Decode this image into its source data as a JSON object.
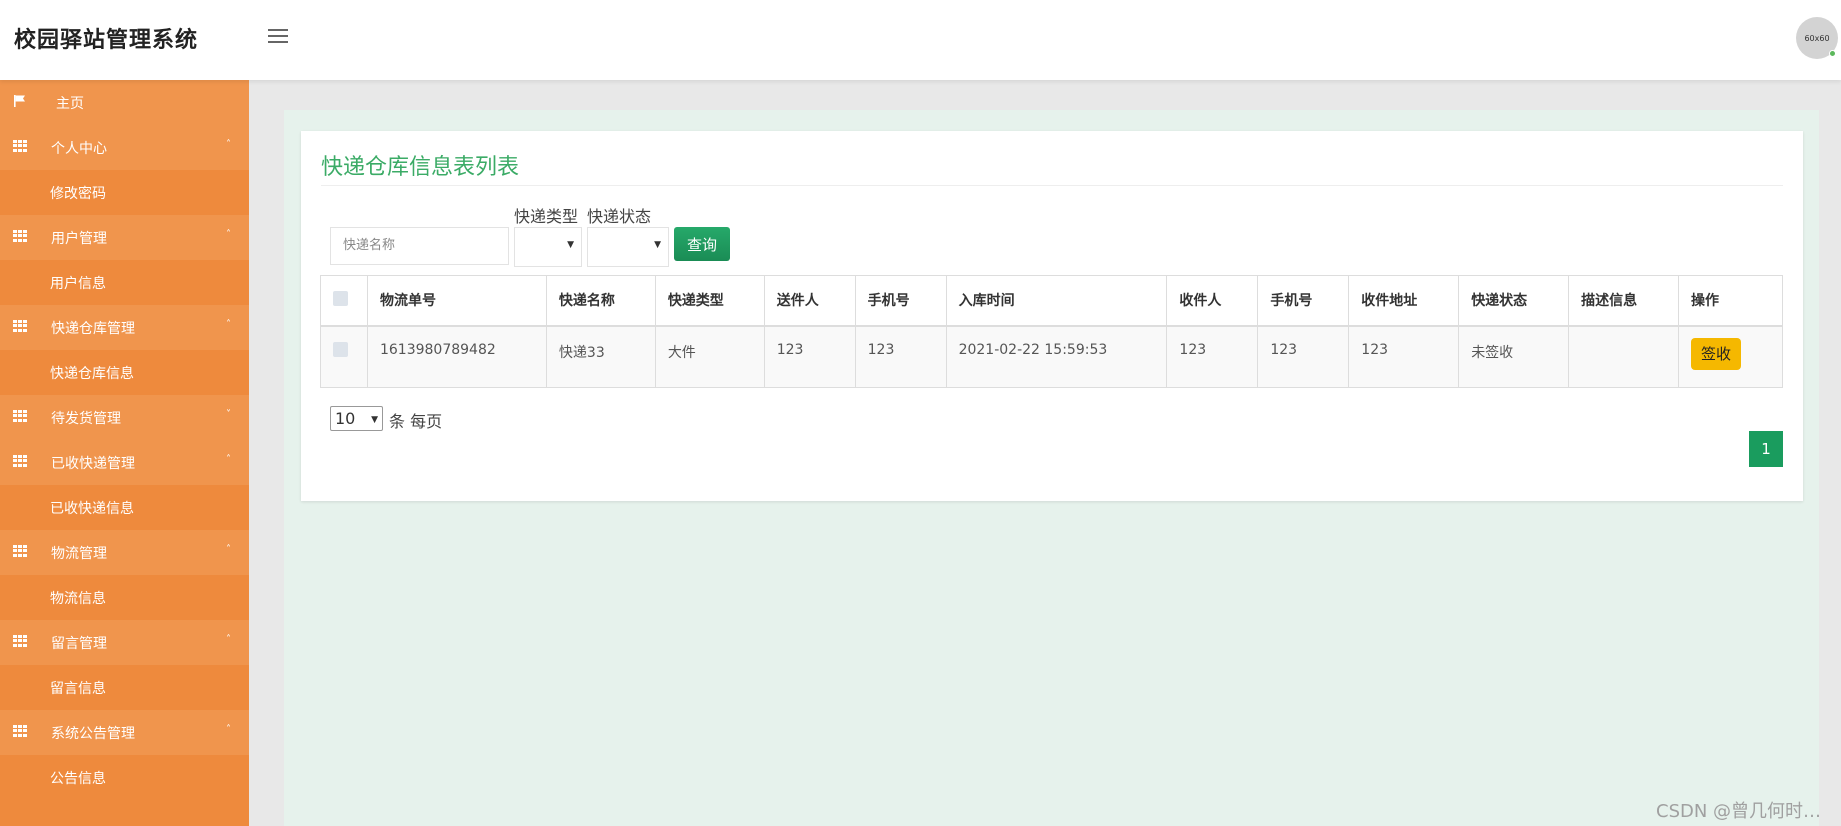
{
  "header": {
    "title": "校园驿站管理系统",
    "avatar_text": "60x60"
  },
  "sidebar": {
    "items": [
      {
        "type": "home",
        "label": "主页",
        "icon": "flag-icon"
      },
      {
        "type": "group",
        "label": "个人中心",
        "icon": "grid-icon",
        "caret": "˄"
      },
      {
        "type": "sub",
        "label": "修改密码"
      },
      {
        "type": "group",
        "label": "用户管理",
        "icon": "grid-icon",
        "caret": "˄"
      },
      {
        "type": "sub",
        "label": "用户信息"
      },
      {
        "type": "group",
        "label": "快递仓库管理",
        "icon": "grid-icon",
        "caret": "˄"
      },
      {
        "type": "sub",
        "label": "快递仓库信息"
      },
      {
        "type": "group",
        "label": "待发货管理",
        "icon": "grid-icon",
        "caret": "˅"
      },
      {
        "type": "group",
        "label": "已收快递管理",
        "icon": "grid-icon",
        "caret": "˄"
      },
      {
        "type": "sub",
        "label": "已收快递信息"
      },
      {
        "type": "group",
        "label": "物流管理",
        "icon": "grid-icon",
        "caret": "˄"
      },
      {
        "type": "sub",
        "label": "物流信息"
      },
      {
        "type": "group",
        "label": "留言管理",
        "icon": "grid-icon",
        "caret": "˄"
      },
      {
        "type": "sub",
        "label": "留言信息"
      },
      {
        "type": "group",
        "label": "系统公告管理",
        "icon": "grid-icon",
        "caret": "˄"
      },
      {
        "type": "sub",
        "label": "公告信息"
      }
    ]
  },
  "main": {
    "title": "快递仓库信息表列表",
    "search": {
      "placeholder": "快递名称"
    },
    "filters": {
      "type_label": "快递类型",
      "status_label": "快递状态"
    },
    "query_label": "查询",
    "table": {
      "columns": [
        "物流单号",
        "快递名称",
        "快递类型",
        "送件人",
        "手机号",
        "入库时间",
        "收件人",
        "手机号",
        "收件地址",
        "快递状态",
        "描述信息",
        "操作"
      ],
      "rows": [
        [
          "1613980789482",
          "快递33",
          "大件",
          "123",
          "123",
          "2021-02-22 15:59:53",
          "123",
          "123",
          "123",
          "未签收",
          "",
          "签收"
        ]
      ]
    },
    "pagination": {
      "page_size": "10",
      "page_size_label": "条 每页",
      "current_page": "1"
    }
  },
  "watermark": "CSDN @曾几何时…"
}
